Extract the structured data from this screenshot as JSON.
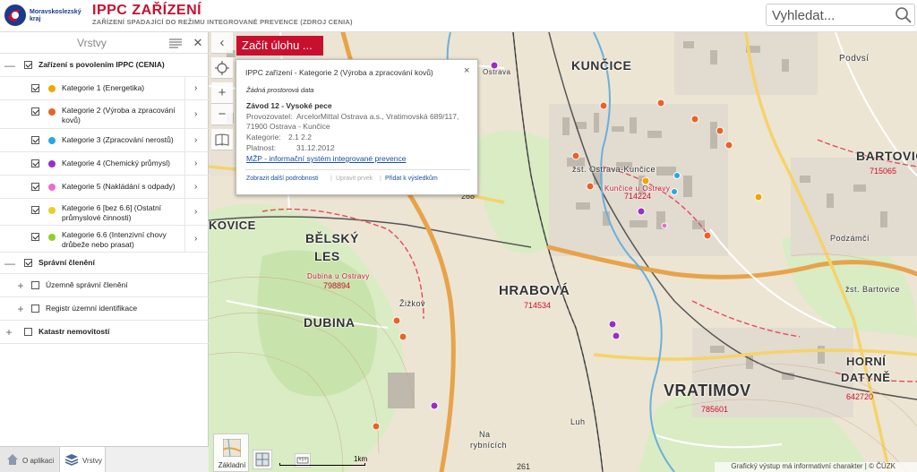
{
  "header": {
    "logo_text_line1": "Moravskoslezský",
    "logo_text_line2": "kraj",
    "title": "IPPC ZAŘÍZENÍ",
    "subtitle": "ZAŘÍZENÍ SPADAJÍCÍ DO REŽIMU INTEGROVANÉ PREVENCE (ZDROJ CENIA)",
    "search_placeholder": "Vyhledat..."
  },
  "sidebar": {
    "title": "Vrstvy",
    "group_ippc": {
      "label": "Zařízení s povolením IPPC (CENIA)",
      "toggle": "—"
    },
    "categories": [
      {
        "label_1": "Kategorie 1 (Energetika)",
        "label_2": "",
        "color": "#f0a500"
      },
      {
        "label_1": "Kategorie 2 (Výroba a zpracování",
        "label_2": "kovů)",
        "color": "#e8632a"
      },
      {
        "label_1": "Kategorie 3 (Zpracování nerostů)",
        "label_2": "",
        "color": "#2aa7e0"
      },
      {
        "label_1": "Kategorie 4 (Chemický průmysl)",
        "label_2": "",
        "color": "#9a2ec4"
      },
      {
        "label_1": "Kategorie 5 (Nakládání s odpady)",
        "label_2": "",
        "color": "#e86ed0"
      },
      {
        "label_1": "Kategorie 6 [bez 6.6] (Ostatní",
        "label_2": "průmyslové činnosti)",
        "color": "#e8d02a"
      },
      {
        "label_1": "Kategorie 6.6 (Intenzivní chovy",
        "label_2": "drůbeže nebo prasat)",
        "color": "#8ed22a"
      }
    ],
    "group_admin": {
      "label": "Správní členění",
      "toggle": "—"
    },
    "admin_items": [
      {
        "label": "Územně správní členění",
        "toggle": "+"
      },
      {
        "label": "Registr územní identifikace",
        "toggle": "+"
      }
    ],
    "group_cadastre": {
      "label": "Katastr nemovitostí",
      "toggle": "+"
    }
  },
  "bottom_tabs": {
    "about": "O aplikaci",
    "layers": "Vrstvy"
  },
  "map": {
    "start_task": "Začít úlohu ...",
    "basemap_label": "Základní",
    "scale_label": "1km",
    "attribution": "Grafický výstup má informativní charakter | © ČÚZK",
    "places": [
      {
        "name": "KUNČICE",
        "size": 14
      },
      {
        "name": "BARTOVICE",
        "size": 14
      },
      {
        "name": "BĚLSKÝ",
        "size": 14
      },
      {
        "name": "LES",
        "size": 14
      },
      {
        "name": "HRABOVÁ",
        "size": 15
      },
      {
        "name": "DUBINA",
        "size": 14
      },
      {
        "name": "VRATIMOV",
        "size": 18
      },
      {
        "name": "HORNÍ",
        "size": 13
      },
      {
        "name": "DATYNĚ",
        "size": 13
      },
      {
        "name": "KOVICE",
        "size": 13
      },
      {
        "name": "Podvsí",
        "size": 10
      },
      {
        "name": "Žižkov",
        "size": 9
      },
      {
        "name": "Luh",
        "size": 9
      },
      {
        "name": "Na",
        "size": 9
      },
      {
        "name": "rybnících",
        "size": 9
      },
      {
        "name": "Podzámčí",
        "size": 9
      },
      {
        "name": "žst. Ostrava-Kunčice",
        "size": 9
      },
      {
        "name": "žst. Bartovice",
        "size": 9
      },
      {
        "name": "Kunčice u Ostravy",
        "size": 8
      },
      {
        "name": "Dubina u Ostravy",
        "size": 8
      },
      {
        "name": "Ostrava",
        "size": 8
      }
    ],
    "codes": [
      "714224",
      "715065",
      "798894",
      "714534",
      "785601",
      "642720",
      "261",
      "268"
    ]
  },
  "popup": {
    "title": "IPPC zařízení - Kategorie 2 (Výroba a zpracování kovů)",
    "close": "×",
    "no_spatial": "Žádná prostorová data",
    "name": "Závod 12 - Vysoké pece",
    "operator_label": "Provozovatel:",
    "operator_value_1": "ArcelorMittal Ostrava a.s., Vratimovská 689/117,",
    "operator_value_2": "71900 Ostrava - Kunčice",
    "category_label": "Kategorie:",
    "category_value": "2.1  2.2",
    "validity_label": "Platnost:",
    "validity_value": "31.12.2012",
    "link": "MŽP - informační systém integrované prevence",
    "action_details": "Zobrazit další podrobnosti",
    "action_edit": "Upravit prvek",
    "action_add": "Přidat k výsledkům"
  }
}
